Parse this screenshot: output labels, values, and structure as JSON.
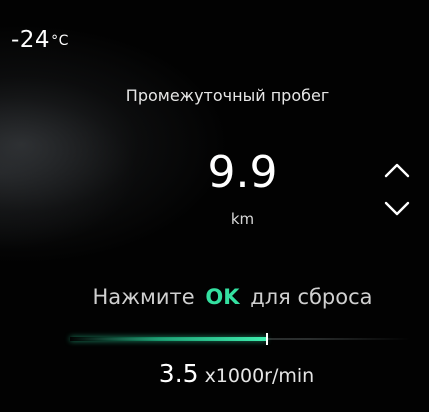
{
  "status": {
    "outside_temperature": "-24",
    "temperature_unit": "°C"
  },
  "menu": {
    "title": "Промежуточный пробег"
  },
  "trip": {
    "value": "9.9",
    "unit": "km"
  },
  "navigation": {
    "up_icon": "chevron-up-icon",
    "down_icon": "chevron-down-icon"
  },
  "reset_hint": {
    "prefix": "Нажмите",
    "key": "OK",
    "suffix": "для сброса"
  },
  "tachometer": {
    "value": "3.5",
    "unit": "x1000r/min",
    "fill_fraction": 0.58
  },
  "colors": {
    "accent": "#34e0a0",
    "background": "#020202",
    "text": "#ffffff"
  }
}
